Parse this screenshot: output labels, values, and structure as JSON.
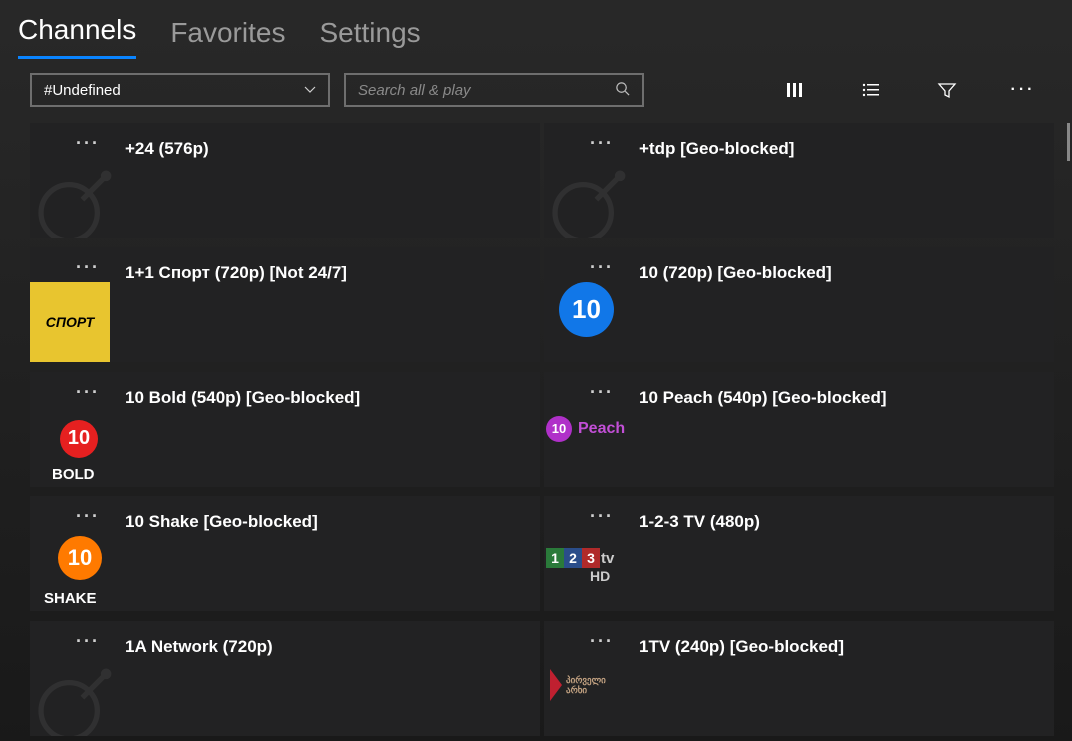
{
  "tabs": {
    "items": [
      "Channels",
      "Favorites",
      "Settings"
    ],
    "active_index": 0
  },
  "dropdown": {
    "selected": "#Undefined"
  },
  "search": {
    "placeholder": "Search all & play",
    "value": ""
  },
  "toolbar_icons": [
    "columns-icon",
    "list-icon",
    "filter-icon",
    "more-icon"
  ],
  "channels": [
    {
      "title": "+24 (576p)",
      "thumb": "dish"
    },
    {
      "title": "+tdp [Geo-blocked]",
      "thumb": "dish"
    },
    {
      "title": "1+1 Спорт (720p) [Not 24/7]",
      "thumb": "sport"
    },
    {
      "title": "10 (720p) [Geo-blocked]",
      "thumb": "ten-blue"
    },
    {
      "title": "10 Bold (540p) [Geo-blocked]",
      "thumb": "ten-bold"
    },
    {
      "title": "10 Peach (540p) [Geo-blocked]",
      "thumb": "ten-peach"
    },
    {
      "title": "10 Shake [Geo-blocked]",
      "thumb": "ten-shake"
    },
    {
      "title": "1-2-3 TV (480p)",
      "thumb": "tv123"
    },
    {
      "title": "1A Network (720p)",
      "thumb": "dish"
    },
    {
      "title": "1TV (240p) [Geo-blocked]",
      "thumb": "georgian"
    }
  ],
  "thumb_text": {
    "sport": "СПОРТ",
    "ten": "10",
    "bold": "BOLD",
    "shake": "SHAKE",
    "peach": "Peach",
    "tv": "tv",
    "hd": "HD",
    "n1": "1",
    "n2": "2",
    "n3": "3",
    "geo1": "პირველი",
    "geo2": "არხი"
  }
}
